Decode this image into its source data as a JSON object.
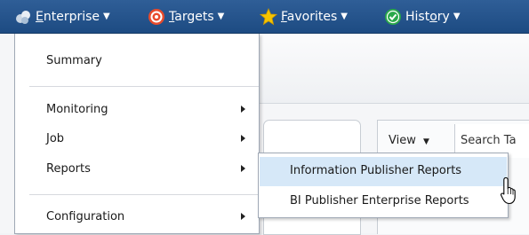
{
  "menubar": {
    "items": [
      {
        "pre": "",
        "accel": "E",
        "post": "nterprise",
        "icon": "enterprise-icon"
      },
      {
        "pre": "",
        "accel": "T",
        "post": "argets",
        "icon": "targets-icon"
      },
      {
        "pre": "",
        "accel": "F",
        "post": "avorites",
        "icon": "favorites-star-icon"
      },
      {
        "pre": "Hist",
        "accel": "o",
        "post": "ry",
        "icon": "history-check-icon"
      }
    ],
    "caret": "▼"
  },
  "enterprise_menu": {
    "items": [
      "Summary",
      "Monitoring",
      "Job",
      "Reports",
      "Configuration"
    ]
  },
  "reports_submenu": {
    "items": [
      "Information Publisher Reports",
      "BI Publisher Enterprise Reports"
    ],
    "highlighted_index": 0
  },
  "background": {
    "view_label": "View",
    "search_label": "Search Ta"
  },
  "colors": {
    "menubar": "#1d4b82",
    "highlight": "#d6e8f8"
  }
}
